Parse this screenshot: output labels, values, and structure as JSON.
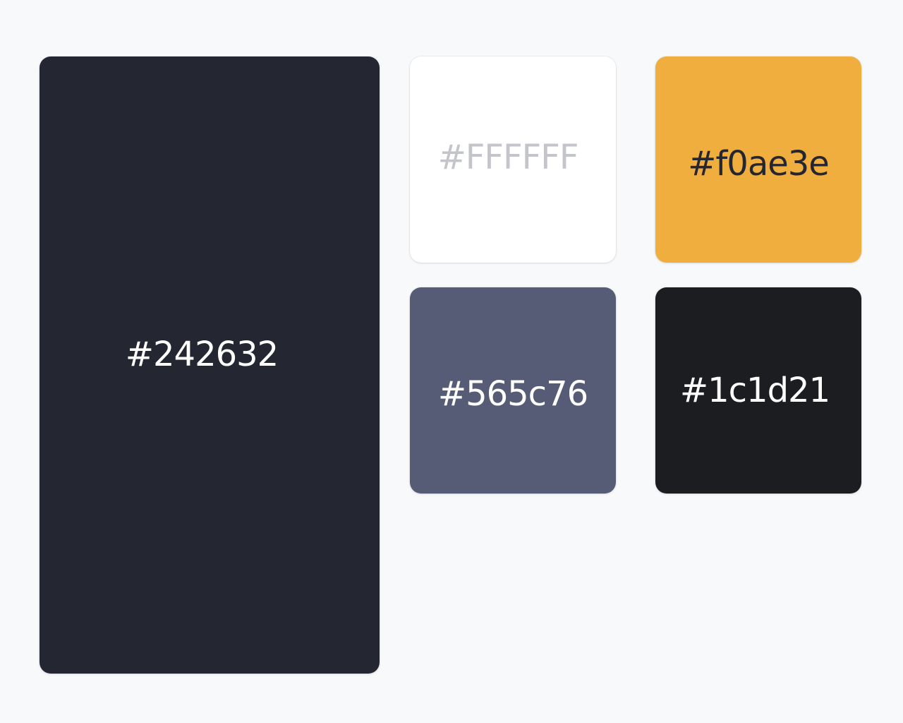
{
  "palette": {
    "swatches": [
      {
        "label": "#242632",
        "color": "#242632",
        "text_color": "#ffffff"
      },
      {
        "label": "#FFFFFF",
        "color": "#FFFFFF",
        "text_color": "#c3c5ca"
      },
      {
        "label": "#f0ae3e",
        "color": "#f0ae3e",
        "text_color": "#242632"
      },
      {
        "label": "#565c76",
        "color": "#565c76",
        "text_color": "#ffffff"
      },
      {
        "label": "#1c1d21",
        "color": "#1c1d21",
        "text_color": "#ffffff"
      }
    ]
  }
}
